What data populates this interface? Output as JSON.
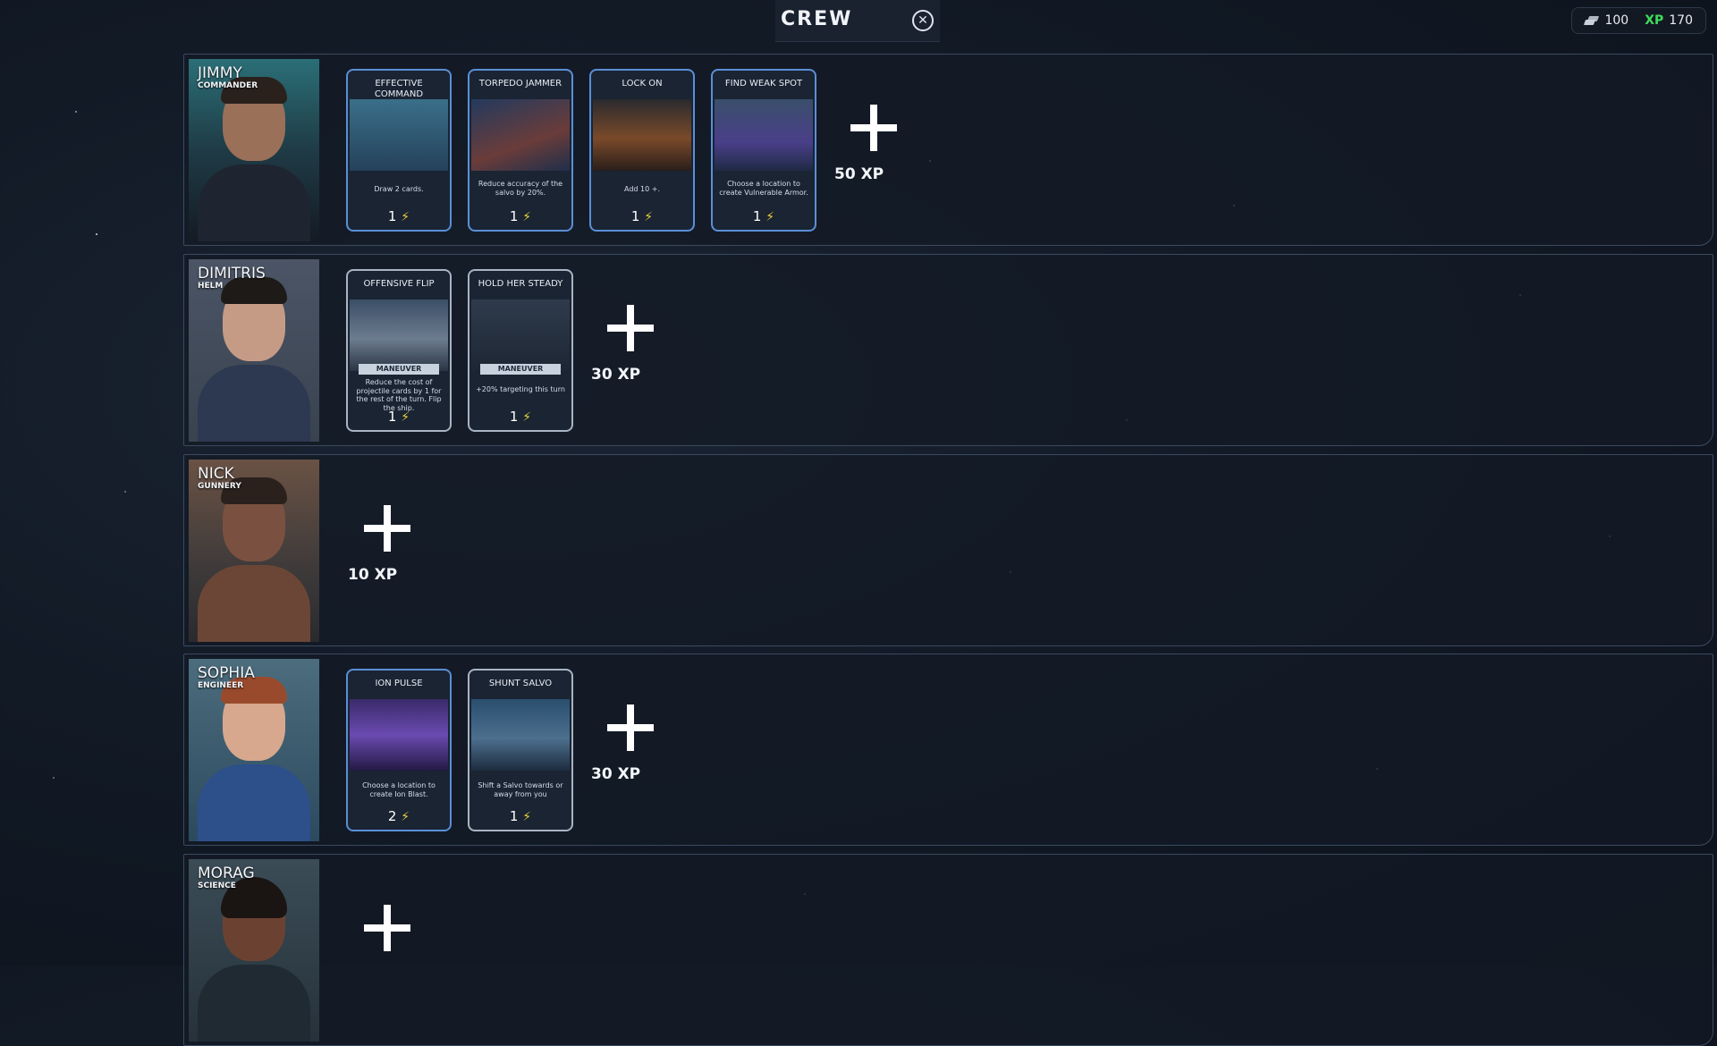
{
  "header": {
    "title": "CREW",
    "close_glyph": "⊗"
  },
  "currency": {
    "credits": "100",
    "xp_label": "XP",
    "xp_value": "170"
  },
  "crew": [
    {
      "name": "JIMMY",
      "role": "COMMANDER",
      "cards": [
        {
          "title": "EFFECTIVE COMMAND",
          "desc": "Draw 2 cards.",
          "cost": "1"
        },
        {
          "title": "TORPEDO JAMMER",
          "desc": "Reduce accuracy of the salvo by 20%.",
          "cost": "1"
        },
        {
          "title": "LOCK ON",
          "desc": "Add 10 +.",
          "cost": "1"
        },
        {
          "title": "FIND WEAK SPOT",
          "desc": "Choose a location to create Vulnerable Armor.",
          "cost": "1"
        }
      ],
      "add_cost": "50 XP"
    },
    {
      "name": "DIMITRIS",
      "role": "HELM",
      "cards": [
        {
          "title": "OFFENSIVE FLIP",
          "tag": "MANEUVER",
          "desc": "Reduce the cost of projectile cards by 1 for the rest of the turn. Flip the ship.",
          "cost": "1"
        },
        {
          "title": "HOLD HER STEADY",
          "tag": "MANEUVER",
          "desc": "+20% targeting this turn",
          "cost": "1"
        }
      ],
      "add_cost": "30 XP"
    },
    {
      "name": "NICK",
      "role": "GUNNERY",
      "cards": [],
      "add_cost": "10 XP"
    },
    {
      "name": "SOPHIA",
      "role": "ENGINEER",
      "cards": [
        {
          "title": "ION PULSE",
          "desc": "Choose a location to create Ion Blast.",
          "cost": "2"
        },
        {
          "title": "SHUNT SALVO",
          "desc": "Shift a Salvo towards or away from you",
          "cost": "1"
        }
      ],
      "add_cost": "30 XP"
    },
    {
      "name": "MORAG",
      "role": "SCIENCE",
      "cards": [],
      "add_cost": ""
    }
  ],
  "colors": {
    "card_border_blue": "#5b8fd6",
    "card_border_grey": "#a8b4c2",
    "xp_green": "#3fdc5a",
    "energy_yellow": "#e6d23a"
  }
}
